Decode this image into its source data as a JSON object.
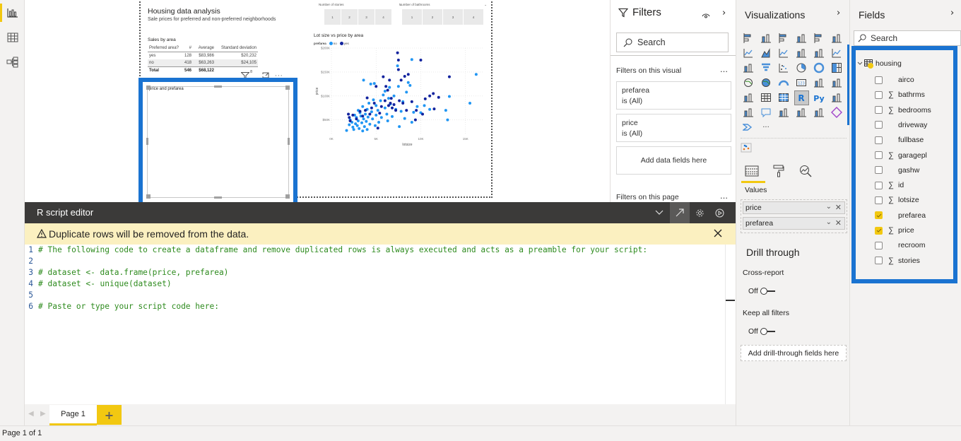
{
  "left_rail": {
    "items": [
      {
        "icon": "report-view-icon",
        "active": true
      },
      {
        "icon": "data-view-icon",
        "active": false
      },
      {
        "icon": "model-view-icon",
        "active": false
      }
    ]
  },
  "report": {
    "title": "Housing data analysis",
    "subtitle": "Sale prices for preferred and non-preferred neighborhoods",
    "sales_table": {
      "title": "Sales by area",
      "columns": [
        "Preferred area?",
        "#",
        "Average",
        "Standard deviation"
      ],
      "rows": [
        [
          "yes",
          "128",
          "$83,986",
          "$20,232"
        ],
        [
          "no",
          "418",
          "$63,263",
          "$24,105"
        ]
      ],
      "total": [
        "Total",
        "546",
        "$68,122",
        ""
      ]
    },
    "slicers": [
      {
        "title": "Number of stories",
        "options": [
          "1",
          "2",
          "3",
          "4"
        ]
      },
      {
        "title": "Number of bathrooms",
        "options": [
          "1",
          "2",
          "3",
          "4"
        ]
      }
    ],
    "visual_header": {
      "filter_count": "8"
    },
    "r_visual": {
      "title": "price and prefarea"
    }
  },
  "chart_data": {
    "type": "scatter",
    "title": "Lot size vs price by area",
    "legend_title": "prefarea",
    "legend": [
      {
        "name": "no",
        "color": "#2196f3"
      },
      {
        "name": "yes",
        "color": "#12239e"
      }
    ],
    "legend_position": "top-left",
    "xlabel": "lotsize",
    "ylabel": "price",
    "x_ticks": [
      "0K",
      "5K",
      "10K",
      "15K"
    ],
    "y_ticks": [
      "$50K",
      "$100K",
      "$150K",
      "$200K"
    ],
    "xlim": [
      0,
      17000
    ],
    "ylim": [
      20000,
      200000
    ],
    "grid": true,
    "series": [
      {
        "name": "no",
        "points": [
          [
            1700,
            28000
          ],
          [
            2000,
            40000
          ],
          [
            2100,
            50000
          ],
          [
            2300,
            45000
          ],
          [
            2400,
            35000
          ],
          [
            2500,
            30000
          ],
          [
            2600,
            60000
          ],
          [
            2700,
            42000
          ],
          [
            2800,
            55000
          ],
          [
            2900,
            38000
          ],
          [
            3000,
            48000
          ],
          [
            3000,
            70000
          ],
          [
            3100,
            32000
          ],
          [
            3200,
            65000
          ],
          [
            3300,
            58000
          ],
          [
            3400,
            44000
          ],
          [
            3500,
            78000
          ],
          [
            3500,
            27000
          ],
          [
            3600,
            52000
          ],
          [
            3600,
            133000
          ],
          [
            3700,
            36000
          ],
          [
            3800,
            62000
          ],
          [
            3900,
            47000
          ],
          [
            4000,
            72000
          ],
          [
            4000,
            30000
          ],
          [
            4100,
            56000
          ],
          [
            4200,
            85000
          ],
          [
            4300,
            41000
          ],
          [
            4400,
            125000
          ],
          [
            4500,
            67000
          ],
          [
            4600,
            52000
          ],
          [
            4700,
            92000
          ],
          [
            4800,
            126000
          ],
          [
            4900,
            38000
          ],
          [
            5000,
            60000
          ],
          [
            5000,
            80000
          ],
          [
            5200,
            70000
          ],
          [
            5300,
            45000
          ],
          [
            5500,
            90000
          ],
          [
            5600,
            55000
          ],
          [
            5800,
            102000
          ],
          [
            6000,
            75000
          ],
          [
            6000,
            110000
          ],
          [
            6200,
            62000
          ],
          [
            6300,
            48000
          ],
          [
            6400,
            95000
          ],
          [
            6500,
            118000
          ],
          [
            6600,
            83000
          ],
          [
            6800,
            57000
          ],
          [
            7000,
            100000
          ],
          [
            7200,
            72000
          ],
          [
            7400,
            163000
          ],
          [
            7500,
            120000
          ],
          [
            7600,
            36000
          ],
          [
            7800,
            68000
          ],
          [
            8000,
            88000
          ],
          [
            8200,
            53000
          ],
          [
            8400,
            108000
          ],
          [
            8600,
            128000
          ],
          [
            8800,
            122000
          ],
          [
            9000,
            176000
          ],
          [
            9000,
            45000
          ],
          [
            9200,
            66000
          ],
          [
            9600,
            78000
          ],
          [
            10000,
            65000
          ],
          [
            10400,
            80000
          ],
          [
            11000,
            72000
          ],
          [
            12800,
            70000
          ],
          [
            13000,
            50000
          ],
          [
            13200,
            99000
          ],
          [
            15500,
            85000
          ],
          [
            16200,
            145000
          ]
        ]
      },
      {
        "name": "yes",
        "points": [
          [
            1900,
            62000
          ],
          [
            2000,
            55000
          ],
          [
            2100,
            48000
          ],
          [
            2400,
            60000
          ],
          [
            2800,
            52000
          ],
          [
            3200,
            68000
          ],
          [
            3500,
            58000
          ],
          [
            3800,
            70000
          ],
          [
            4000,
            96000
          ],
          [
            4300,
            62000
          ],
          [
            4500,
            75000
          ],
          [
            4800,
            85000
          ],
          [
            5000,
            120000
          ],
          [
            5200,
            33000
          ],
          [
            5400,
            64000
          ],
          [
            5600,
            78000
          ],
          [
            5800,
            140000
          ],
          [
            6000,
            90000
          ],
          [
            6100,
            120000
          ],
          [
            6300,
            112000
          ],
          [
            6400,
            80000
          ],
          [
            6500,
            133000
          ],
          [
            6600,
            85000
          ],
          [
            6700,
            95000
          ],
          [
            6800,
            75000
          ],
          [
            7000,
            82000
          ],
          [
            7200,
            70000
          ],
          [
            7400,
            190000
          ],
          [
            7500,
            175000
          ],
          [
            7500,
            155000
          ],
          [
            7600,
            90000
          ],
          [
            7800,
            133000
          ],
          [
            8000,
            85000
          ],
          [
            8200,
            141000
          ],
          [
            8400,
            70000
          ],
          [
            8600,
            145000
          ],
          [
            9000,
            88000
          ],
          [
            9400,
            50000
          ],
          [
            9500,
            70000
          ],
          [
            10000,
            175000
          ],
          [
            10200,
            62000
          ],
          [
            10500,
            94000
          ],
          [
            11000,
            100000
          ],
          [
            11400,
            105000
          ],
          [
            11500,
            73000
          ],
          [
            12000,
            97000
          ],
          [
            13200,
            140000
          ]
        ]
      }
    ]
  },
  "r_editor": {
    "title": "R script editor",
    "warning": "Duplicate rows will be removed from the data.",
    "lines": [
      {
        "n": "1",
        "text": "# The following code to create a dataframe and remove duplicated rows is always executed and acts as a preamble for your script:"
      },
      {
        "n": "2",
        "text": ""
      },
      {
        "n": "3",
        "text": "# dataset <- data.frame(price, prefarea)"
      },
      {
        "n": "4",
        "text": "# dataset <- unique(dataset)"
      },
      {
        "n": "5",
        "text": ""
      },
      {
        "n": "6",
        "text": "# Paste or type your script code here:"
      }
    ]
  },
  "page_tabs": {
    "tabs": [
      "Page 1"
    ],
    "add_label": "+"
  },
  "status": {
    "text": "Page 1 of 1"
  },
  "filters": {
    "title": "Filters",
    "search_placeholder": "Search",
    "visual_section": "Filters on this visual",
    "visual_filters": [
      {
        "field": "prefarea",
        "state": "is (All)"
      },
      {
        "field": "price",
        "state": "is (All)"
      }
    ],
    "add_fields": "Add data fields here",
    "page_section": "Filters on this page"
  },
  "visualizations": {
    "title": "Visualizations",
    "selected_visual": "R script visual",
    "values_label": "Values",
    "values": [
      "price",
      "prefarea"
    ],
    "drill_title": "Drill through",
    "cross_report_label": "Cross-report",
    "cross_report_state": "Off",
    "keep_filters_label": "Keep all filters",
    "keep_filters_state": "Off",
    "drill_fields": "Add drill-through fields here"
  },
  "fields": {
    "title": "Fields",
    "search_placeholder": "Search",
    "table": "housing",
    "items": [
      {
        "name": "airco",
        "sigma": false,
        "checked": false
      },
      {
        "name": "bathrms",
        "sigma": true,
        "checked": false
      },
      {
        "name": "bedrooms",
        "sigma": true,
        "checked": false
      },
      {
        "name": "driveway",
        "sigma": false,
        "checked": false
      },
      {
        "name": "fullbase",
        "sigma": false,
        "checked": false
      },
      {
        "name": "garagepl",
        "sigma": true,
        "checked": false
      },
      {
        "name": "gashw",
        "sigma": false,
        "checked": false
      },
      {
        "name": "id",
        "sigma": true,
        "checked": false
      },
      {
        "name": "lotsize",
        "sigma": true,
        "checked": false
      },
      {
        "name": "prefarea",
        "sigma": false,
        "checked": true
      },
      {
        "name": "price",
        "sigma": true,
        "checked": true
      },
      {
        "name": "recroom",
        "sigma": false,
        "checked": false
      },
      {
        "name": "stories",
        "sigma": true,
        "checked": false
      }
    ]
  },
  "colors": {
    "accent": "#f2c811",
    "selection": "#1a73d1",
    "series_no": "#2196f3",
    "series_yes": "#12239e",
    "code_comment": "#2e8b1e"
  }
}
